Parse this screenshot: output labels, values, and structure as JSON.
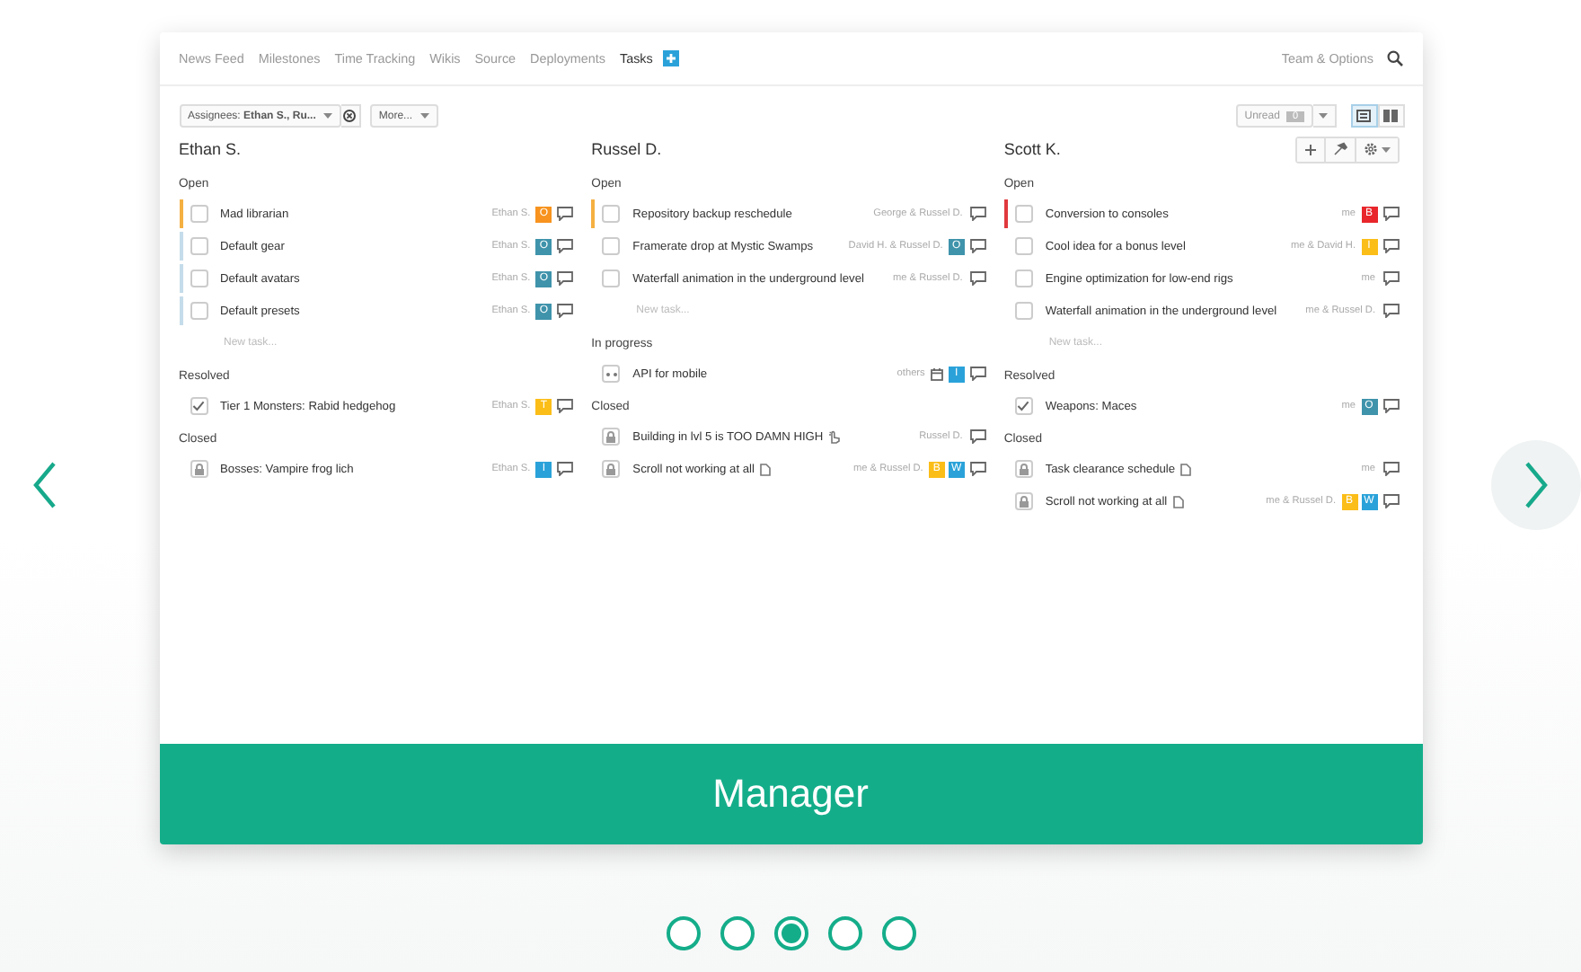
{
  "nav": {
    "tabs": [
      {
        "label": "News Feed",
        "selected": false
      },
      {
        "label": "Milestones",
        "selected": false
      },
      {
        "label": "Time Tracking",
        "selected": false
      },
      {
        "label": "Wikis",
        "selected": false
      },
      {
        "label": "Source",
        "selected": false
      },
      {
        "label": "Deployments",
        "selected": false
      },
      {
        "label": "Tasks",
        "selected": true
      }
    ],
    "right_link": "Team & Options"
  },
  "filters": {
    "assignees": "Assignees: **Ethan S., Ru...**",
    "more": "More...",
    "unread_label": "Unread",
    "unread_count": "0",
    "views": [
      {
        "selected": true
      },
      {
        "selected": false
      }
    ]
  },
  "columns": [
    {
      "name": "Ethan S.",
      "tools": false,
      "groups": [
        {
          "title": "Open",
          "new_task": "New task...",
          "tasks": [
            {
              "kind": "open",
              "title": "Mad librarian",
              "people": "Ethan S.",
              "color": "#f5b042",
              "badges": [
                {
                  "letter": "O",
                  "color": "#f7931e"
                }
              ]
            },
            {
              "kind": "open",
              "title": "Default gear",
              "people": "Ethan S.",
              "color": "#c5dcea",
              "badges": [
                {
                  "letter": "O",
                  "color": "#3f93ab"
                }
              ]
            },
            {
              "kind": "open",
              "title": "Default avatars",
              "people": "Ethan S.",
              "color": "#c5dcea",
              "badges": [
                {
                  "letter": "O",
                  "color": "#3f93ab"
                }
              ]
            },
            {
              "kind": "open",
              "title": "Default presets",
              "people": "Ethan S.",
              "color": "#c5dcea",
              "badges": [
                {
                  "letter": "O",
                  "color": "#3f93ab"
                }
              ]
            }
          ]
        },
        {
          "title": "Resolved",
          "tasks": [
            {
              "kind": "resolved",
              "title": "Tier 1 Monsters: Rabid hedgehog",
              "people": "Ethan S.",
              "badges": [
                {
                  "letter": "T",
                  "color": "#fbbd18"
                }
              ]
            }
          ]
        },
        {
          "title": "Closed",
          "tasks": [
            {
              "kind": "closed",
              "title": "Bosses: Vampire frog lich",
              "people": "Ethan S.",
              "badges": [
                {
                  "letter": "I",
                  "color": "#2aa2d9"
                }
              ]
            }
          ]
        }
      ]
    },
    {
      "name": "Russel D.",
      "tools": false,
      "groups": [
        {
          "title": "Open",
          "new_task": "New task...",
          "tasks": [
            {
              "kind": "open",
              "title": "Repository backup reschedule",
              "people": "George & Russel D.",
              "color": "#f5b042"
            },
            {
              "kind": "open",
              "title": "Framerate drop at Mystic Swamps",
              "people": "David H. & Russel D.",
              "badges": [
                {
                  "letter": "O",
                  "color": "#3f93ab"
                }
              ]
            },
            {
              "kind": "open",
              "title": "Waterfall animation in the underground level",
              "people": "me & Russel D."
            }
          ]
        },
        {
          "title": "In progress",
          "tasks": [
            {
              "kind": "progress",
              "title": "API for mobile",
              "people": "others",
              "meta": [
                {
                  "kind": "calendar"
                }
              ],
              "badges": [
                {
                  "letter": "I",
                  "color": "#2aa2d9"
                }
              ]
            }
          ]
        },
        {
          "title": "Closed",
          "tasks": [
            {
              "kind": "closed",
              "title": "Building in lvl 5 is TOO DAMN HIGH",
              "attachments": [
                {
                  "kind": "hand"
                }
              ],
              "people": "Russel D."
            },
            {
              "kind": "closed",
              "title": "Scroll not working at all",
              "attachments": [
                {
                  "kind": "file"
                }
              ],
              "people": "me & Russel D.",
              "badges": [
                {
                  "letter": "B",
                  "color": "#fbbd18"
                },
                {
                  "letter": "W",
                  "color": "#2aa2d9"
                }
              ]
            }
          ]
        }
      ]
    },
    {
      "name": "Scott K.",
      "tools": true,
      "groups": [
        {
          "title": "Open",
          "new_task": "New task...",
          "tasks": [
            {
              "kind": "open",
              "title": "Conversion to consoles",
              "people": "me",
              "color": "#e0393e",
              "badges": [
                {
                  "letter": "B",
                  "color": "#e8262b"
                }
              ]
            },
            {
              "kind": "open",
              "title": "Cool idea for a bonus level",
              "people": "me & David H.",
              "badges": [
                {
                  "letter": "I",
                  "color": "#fbbd18"
                }
              ]
            },
            {
              "kind": "open",
              "title": "Engine optimization for low-end rigs",
              "people": "me"
            },
            {
              "kind": "open",
              "title": "Waterfall animation in the underground level",
              "people": "me & Russel D."
            }
          ]
        },
        {
          "title": "Resolved",
          "tasks": [
            {
              "kind": "resolved",
              "title": "Weapons: Maces",
              "people": "me",
              "badges": [
                {
                  "letter": "O",
                  "color": "#3f93ab"
                }
              ]
            }
          ]
        },
        {
          "title": "Closed",
          "tasks": [
            {
              "kind": "closed",
              "title": "Task clearance schedule",
              "attachments": [
                {
                  "kind": "file"
                }
              ],
              "people": "me"
            },
            {
              "kind": "closed",
              "title": "Scroll not working at all",
              "attachments": [
                {
                  "kind": "file"
                }
              ],
              "people": "me & Russel D.",
              "badges": [
                {
                  "letter": "B",
                  "color": "#fbbd18"
                },
                {
                  "letter": "W",
                  "color": "#2aa2d9"
                }
              ]
            }
          ]
        }
      ]
    }
  ],
  "banner": "Manager",
  "pager": [
    {
      "selected": false
    },
    {
      "selected": false
    },
    {
      "selected": true
    },
    {
      "selected": false
    },
    {
      "selected": false
    }
  ]
}
